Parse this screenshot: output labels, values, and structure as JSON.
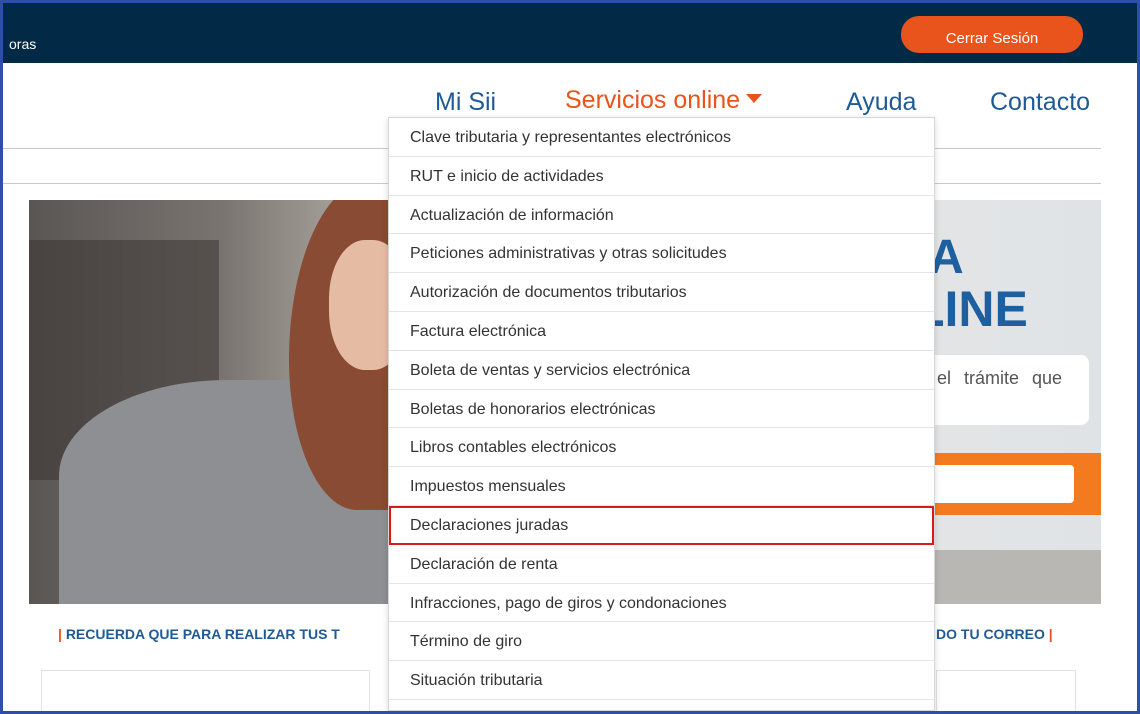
{
  "topbar": {
    "partial_text": "oras",
    "logout_label": "Cerrar Sesión"
  },
  "nav": {
    "mi_sii": "Mi Sii",
    "servicios": "Servicios online",
    "ayuda": "Ayuda",
    "contacto": "Contacto"
  },
  "hero": {
    "heading_fragment_1": "A",
    "heading_fragment_2": "LINE",
    "desc_fragment": "el trámite que"
  },
  "notice": {
    "left": "RECUERDA QUE PARA REALIZAR TUS T",
    "right": "DO TU CORREO"
  },
  "dropdown": {
    "items": [
      "Clave tributaria y representantes electrónicos",
      "RUT e inicio de actividades",
      "Actualización de información",
      "Peticiones administrativas y otras solicitudes",
      "Autorización de documentos tributarios",
      "Factura electrónica",
      "Boleta de ventas y servicios electrónica",
      "Boletas de honorarios electrónicas",
      "Libros contables electrónicos",
      "Impuestos mensuales",
      "Declaraciones juradas",
      "Declaración de renta",
      "Infracciones, pago de giros y condonaciones",
      "Término de giro",
      "Situación tributaria"
    ],
    "highlighted_item": "Declaraciones juradas"
  },
  "colors": {
    "topbar": "#022a47",
    "accent": "#e8541c",
    "link": "#1f5a95",
    "highlight_border": "#d71a1a"
  }
}
